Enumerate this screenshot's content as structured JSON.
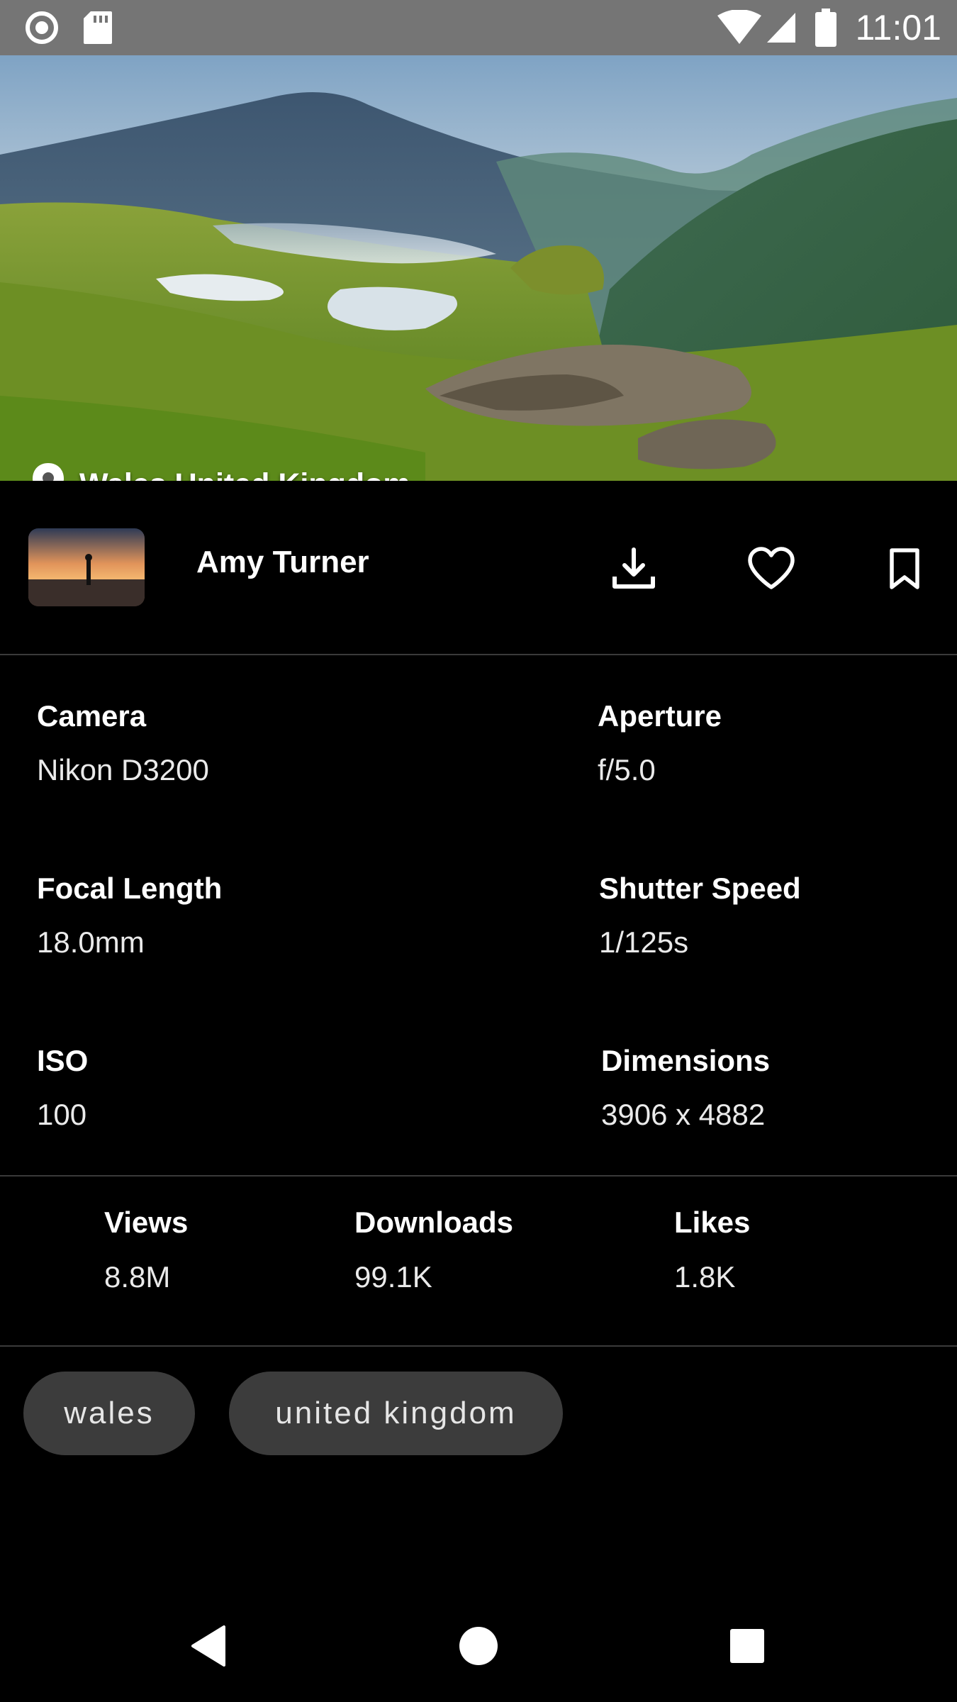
{
  "status_bar": {
    "time": "11:01"
  },
  "photo": {
    "location": "Wales,United Kingdom"
  },
  "author": {
    "name": "Amy Turner"
  },
  "actions": [
    "download-icon",
    "heart-icon",
    "bookmark-icon"
  ],
  "exif": {
    "camera": {
      "label": "Camera",
      "value": "Nikon D3200"
    },
    "aperture": {
      "label": "Aperture",
      "value": "f/5.0"
    },
    "focal_length": {
      "label": "Focal Length",
      "value": "18.0mm"
    },
    "shutter_speed": {
      "label": "Shutter Speed",
      "value": "1/125s"
    },
    "iso": {
      "label": "ISO",
      "value": "100"
    },
    "dimensions": {
      "label": "Dimensions",
      "value": "3906 x 4882"
    }
  },
  "stats": {
    "views": {
      "label": "Views",
      "value": "8.8M"
    },
    "downloads": {
      "label": "Downloads",
      "value": "99.1K"
    },
    "likes": {
      "label": "Likes",
      "value": "1.8K"
    }
  },
  "tags": [
    "wales",
    "united kingdom"
  ],
  "nav": [
    "back-icon",
    "home-icon",
    "recents-icon"
  ]
}
